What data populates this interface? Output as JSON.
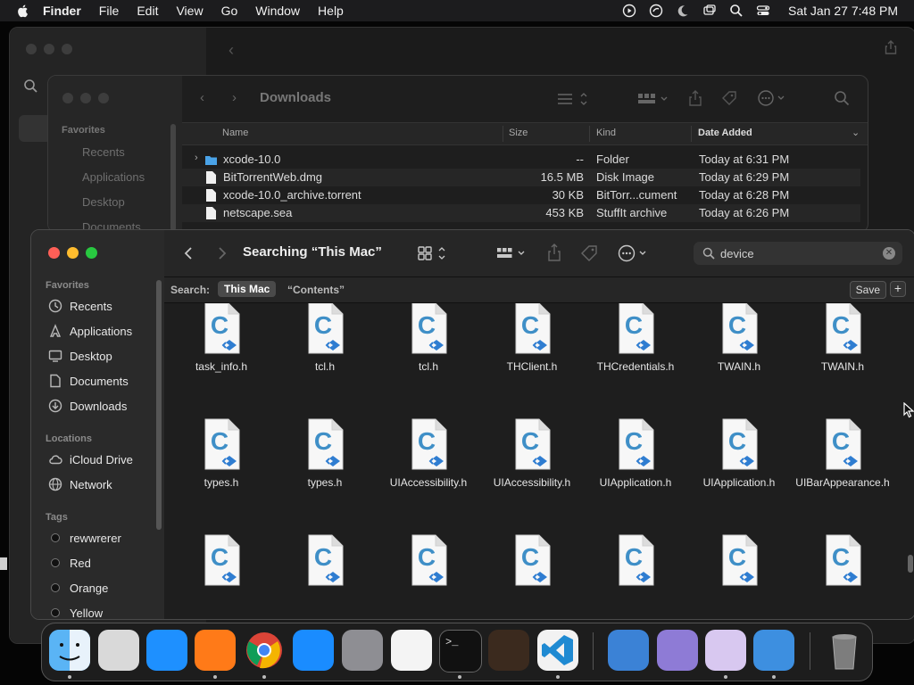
{
  "menubar": {
    "app": "Finder",
    "items": [
      "File",
      "Edit",
      "View",
      "Go",
      "Window",
      "Help"
    ],
    "clock": "Sat Jan 27  7:48 PM"
  },
  "downloads_window": {
    "title": "Downloads",
    "sidebar": {
      "favorites_label": "Favorites",
      "items": [
        "Recents",
        "Applications",
        "Desktop",
        "Documents"
      ]
    },
    "columns": {
      "name": "Name",
      "size": "Size",
      "kind": "Kind",
      "date": "Date Added"
    },
    "rows": [
      {
        "name": "xcode-10.0",
        "size": "--",
        "kind": "Folder",
        "date": "Today at 6:31 PM",
        "type": "folder"
      },
      {
        "name": "BitTorrentWeb.dmg",
        "size": "16.5 MB",
        "kind": "Disk Image",
        "date": "Today at 6:29 PM",
        "type": "doc"
      },
      {
        "name": "xcode-10.0_archive.torrent",
        "size": "30 KB",
        "kind": "BitTorr...cument",
        "date": "Today at 6:28 PM",
        "type": "doc"
      },
      {
        "name": "netscape.sea",
        "size": "453 KB",
        "kind": "StuffIt archive",
        "date": "Today at 6:26 PM",
        "type": "doc"
      }
    ]
  },
  "search_window": {
    "title": "Searching “This Mac”",
    "search_query": "device",
    "scope": {
      "label": "Search:",
      "this_mac": "This Mac",
      "contents": "“Contents”",
      "save": "Save",
      "plus": "+"
    },
    "sidebar": {
      "favorites_label": "Favorites",
      "favorites": [
        {
          "label": "Recents",
          "icon": "clock-icon"
        },
        {
          "label": "Applications",
          "icon": "applications-icon"
        },
        {
          "label": "Desktop",
          "icon": "desktop-icon"
        },
        {
          "label": "Documents",
          "icon": "document-icon"
        },
        {
          "label": "Downloads",
          "icon": "download-icon"
        }
      ],
      "locations_label": "Locations",
      "locations": [
        {
          "label": "iCloud Drive",
          "icon": "cloud-icon"
        },
        {
          "label": "Network",
          "icon": "globe-icon"
        }
      ],
      "tags_label": "Tags",
      "tags": [
        "rewwrerer",
        "Red",
        "Orange",
        "Yellow"
      ]
    },
    "files_row1": [
      "task_info.h",
      "tcl.h",
      "tcl.h",
      "THClient.h",
      "THCredentials.h",
      "TWAIN.h",
      "TWAIN.h"
    ],
    "files_row2": [
      "types.h",
      "types.h",
      "UIAccessibility.h",
      "UIAccessibility.h",
      "UIApplication.h",
      "UIApplication.h",
      "UIBarAppearance.h"
    ],
    "files_row3": [
      "",
      "",
      "",
      "",
      "",
      "",
      ""
    ]
  },
  "dock": {
    "apps": [
      {
        "name": "finder-icon",
        "color": "#2a8cf0"
      },
      {
        "name": "launchpad-icon",
        "color": "#d9d9d9"
      },
      {
        "name": "safari-icon",
        "color": "#1e90ff"
      },
      {
        "name": "firefox-icon",
        "color": "#ff7a18"
      },
      {
        "name": "chrome-icon",
        "color": "#e8e8e8"
      },
      {
        "name": "app-store-icon",
        "color": "#1a8cff"
      },
      {
        "name": "system-settings-icon",
        "color": "#8e8e93"
      },
      {
        "name": "textedit-icon",
        "color": "#f4f4f4"
      },
      {
        "name": "terminal-icon",
        "color": "#111111"
      },
      {
        "name": "garageband-icon",
        "color": "#3b2a1e"
      },
      {
        "name": "vscode-icon",
        "color": "#1f8ad2"
      },
      {
        "name": "weather-icon",
        "color": "#3b82d6"
      },
      {
        "name": "disk-utility-icon",
        "color": "#8e7bd6"
      },
      {
        "name": "bittorrent-icon",
        "color": "#d8c8f0"
      },
      {
        "name": "xcode-folder-icon",
        "color": "#3d8fe0"
      },
      {
        "name": "trash-icon",
        "color": "#8a8a8a"
      }
    ]
  }
}
